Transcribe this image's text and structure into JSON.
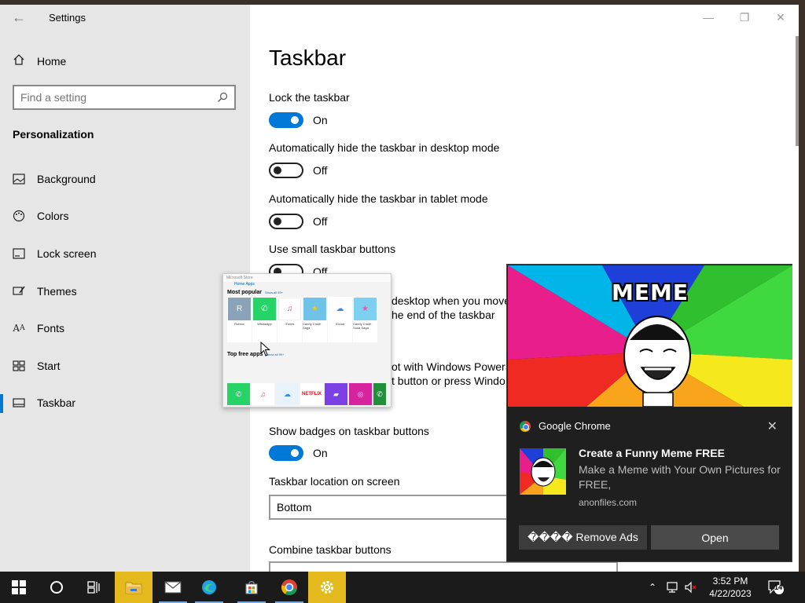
{
  "window": {
    "title": "Settings",
    "controls": {
      "minimize": "—",
      "restore": "❐",
      "close": "✕"
    }
  },
  "nav": {
    "home_label": "Home",
    "search_placeholder": "Find a setting",
    "section": "Personalization",
    "items": [
      {
        "label": "Background",
        "icon": "image-icon"
      },
      {
        "label": "Colors",
        "icon": "palette-icon"
      },
      {
        "label": "Lock screen",
        "icon": "lock-screen-icon"
      },
      {
        "label": "Themes",
        "icon": "brush-icon"
      },
      {
        "label": "Fonts",
        "icon": "font-icon"
      },
      {
        "label": "Start",
        "icon": "start-icon"
      },
      {
        "label": "Taskbar",
        "icon": "taskbar-icon",
        "active": true
      }
    ]
  },
  "content": {
    "page_title": "Taskbar",
    "lock": {
      "label": "Lock the taskbar",
      "state": "On"
    },
    "hide_desktop": {
      "label": "Automatically hide the taskbar in desktop mode",
      "state": "Off"
    },
    "hide_tablet": {
      "label": "Automatically hide the taskbar in tablet mode",
      "state": "Off"
    },
    "small_buttons": {
      "label": "Use small taskbar buttons",
      "state": "Off"
    },
    "peek_line1": "desktop when you move",
    "peek_line2": "he end of the taskbar",
    "ps_line1": "ot with Windows PowerS",
    "ps_line2": "t button or press Windo",
    "badges": {
      "label": "Show badges on taskbar buttons",
      "state": "On"
    },
    "location": {
      "label": "Taskbar location on screen",
      "value": "Bottom"
    },
    "combine": {
      "label": "Combine taskbar buttons"
    }
  },
  "thumbnail": {
    "title": "Microsoft Store",
    "tabs": "Home   Apps",
    "popular_heading": "Most popular",
    "see_all": "Show all 99+",
    "apps": [
      {
        "name": "Roblox",
        "color": "#8aa3b8",
        "glyph": "R"
      },
      {
        "name": "WhatsApp",
        "color": "#25d366",
        "glyph": "✆"
      },
      {
        "name": "iTunes",
        "color": "#ffffff",
        "glyph": "♫"
      },
      {
        "name": "Candy Crush Saga",
        "color": "#6fc3e8",
        "glyph": "★"
      },
      {
        "name": "iCloud",
        "color": "#ffffff",
        "glyph": "☁"
      },
      {
        "name": "Candy Crush Soda Saga",
        "color": "#7ed0f0",
        "glyph": "★"
      },
      {
        "name": "Netflix",
        "color": "#ffffff",
        "glyph": "N"
      }
    ],
    "free_heading": "Top free apps",
    "free_apps": [
      {
        "color": "#25d366",
        "glyph": "✆"
      },
      {
        "color": "#ffffff",
        "glyph": "♫"
      },
      {
        "color": "#e8f2fb",
        "glyph": "☁"
      },
      {
        "color": "#ffffff",
        "glyph": "NETFLIX"
      },
      {
        "color": "#7b3fe4",
        "glyph": "▰"
      },
      {
        "color": "#d6249f",
        "glyph": "◎"
      },
      {
        "color": "#1f8f3a",
        "glyph": "✆"
      }
    ]
  },
  "toast": {
    "hero_text": "MEME",
    "app_name": "Google Chrome",
    "close": "✕",
    "title": "Create a Funny Meme FREE",
    "message": "Make a Meme with Your Own Pictures for FREE,",
    "source": "anonfiles.com",
    "btn_left": "���� Remove Ads",
    "btn_right": "Open"
  },
  "taskbar": {
    "time": "3:52 PM",
    "date": "4/22/2023",
    "notification_count": "14",
    "accent": "#e3b91e"
  }
}
